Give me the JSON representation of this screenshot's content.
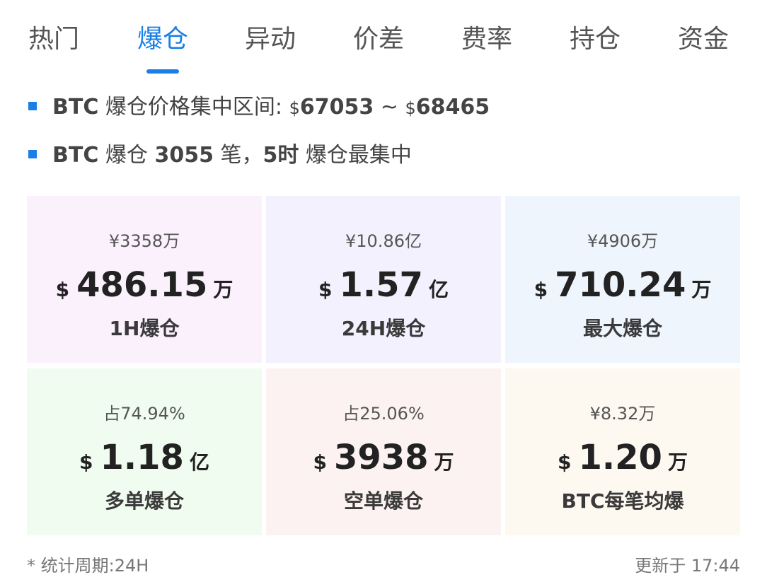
{
  "tabs": [
    {
      "label": "热门"
    },
    {
      "label": "爆仓"
    },
    {
      "label": "异动"
    },
    {
      "label": "价差"
    },
    {
      "label": "费率"
    },
    {
      "label": "持仓"
    },
    {
      "label": "资金"
    }
  ],
  "summary": {
    "line1": {
      "coin": "BTC",
      "text": "爆仓价格集中区间:",
      "currency": "$",
      "low": "67053",
      "separator": "~",
      "high": "68465"
    },
    "line2": {
      "coin": "BTC",
      "text_a": "爆仓",
      "count": "3055",
      "text_b": "笔，",
      "hour": "5时",
      "text_c": "爆仓最集中"
    }
  },
  "cards": [
    {
      "sub": "¥3358万",
      "currency": "$",
      "value": "486.15",
      "unit": "万",
      "label": "1H爆仓",
      "bg": "#fbf1fd"
    },
    {
      "sub": "¥10.86亿",
      "currency": "$",
      "value": "1.57",
      "unit": "亿",
      "label": "24H爆仓",
      "bg": "#f3f1fd"
    },
    {
      "sub": "¥4906万",
      "currency": "$",
      "value": "710.24",
      "unit": "万",
      "label": "最大爆仓",
      "bg": "#eff5fd"
    },
    {
      "sub": "占74.94%",
      "currency": "$",
      "value": "1.18",
      "unit": "亿",
      "label": "多单爆仓",
      "bg": "#f0fcef"
    },
    {
      "sub": "占25.06%",
      "currency": "$",
      "value": "3938",
      "unit": "万",
      "label": "空单爆仓",
      "bg": "#fdf2f2"
    },
    {
      "sub": "¥8.32万",
      "currency": "$",
      "value": "1.20",
      "unit": "万",
      "label": "BTC每笔均爆",
      "bg": "#fdf8f0"
    }
  ],
  "footer": {
    "period": "* 统计周期:24H",
    "updated": "更新于 17:44"
  },
  "colors": {
    "accent": "#1a7fe6"
  }
}
